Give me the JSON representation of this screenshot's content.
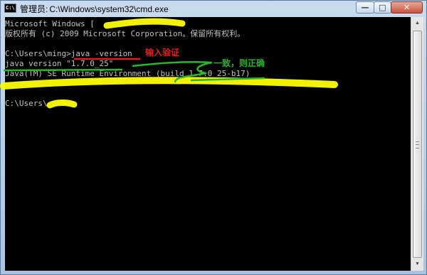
{
  "window": {
    "title_prefix": "管理员:",
    "title_path": "C:\\Windows\\system32\\cmd.exe",
    "minimize_label": "—",
    "maximize_label": "□",
    "close_label": "✕",
    "app_icon_text": "C:\\"
  },
  "console": {
    "lines": [
      "Microsoft Windows [",
      "版权所有 (c) 2009 Microsoft Corporation。保留所有权利。",
      "",
      "C:\\Users\\ming>java -version",
      "java version \"1.7.0_25\"",
      "Java(TM) SE Runtime Environment (build 1.7.0_25-b17)",
      "",
      "",
      "C:\\Users\\   >"
    ]
  },
  "annotations": {
    "verify_label": "输入验证",
    "consistent_label": "一致，则正确",
    "verify_color": "#e02020",
    "consistent_color": "#2db52d",
    "highlighter_color": "#ffff00"
  },
  "scrollbar": {
    "up_icon": "scroll-up-arrow-icon",
    "down_icon": "scroll-down-arrow-icon"
  }
}
